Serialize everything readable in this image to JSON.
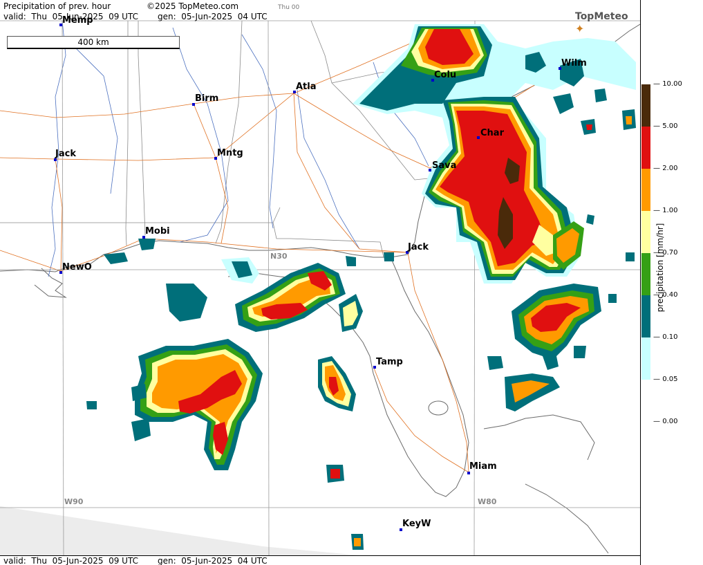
{
  "header": {
    "title": "Precipitation of prev. hour",
    "copyright": "©2025 TopMeteo.com",
    "run": "Thu 00",
    "valid": "valid:  Thu  05-Jun-2025  09 UTC",
    "gen": "gen:  05-Jun-2025  04 UTC",
    "logo": "TopMeteo"
  },
  "footer": {
    "valid": "valid:  Thu  05-Jun-2025  09 UTC",
    "gen": "gen:  05-Jun-2025  04 UTC"
  },
  "scale_bar": {
    "label": "400 km"
  },
  "grid_labels": {
    "w90": "W90",
    "w80": "W80",
    "n30": "N30"
  },
  "cities": [
    {
      "name": "Memp"
    },
    {
      "name": "Birm"
    },
    {
      "name": "Atla"
    },
    {
      "name": "Colu"
    },
    {
      "name": "Wilm"
    },
    {
      "name": "Jack"
    },
    {
      "name": "Mntg"
    },
    {
      "name": "Char"
    },
    {
      "name": "Sava"
    },
    {
      "name": "Mobi"
    },
    {
      "name": "Jack"
    },
    {
      "name": "NewO"
    },
    {
      "name": "Tamp"
    },
    {
      "name": "Miam"
    },
    {
      "name": "KeyW"
    }
  ],
  "legend": {
    "title": "precipitation  [mm/hr]",
    "ticks": [
      "10.00",
      "5.00",
      "2.00",
      "1.00",
      "0.70",
      "0.40",
      "0.10",
      "0.05",
      "0.00"
    ],
    "colors": [
      "#4a2a0a",
      "#e01010",
      "#ff9a00",
      "#ffffa0",
      "#35a015",
      "#006f7a",
      "#c8ffff"
    ]
  }
}
